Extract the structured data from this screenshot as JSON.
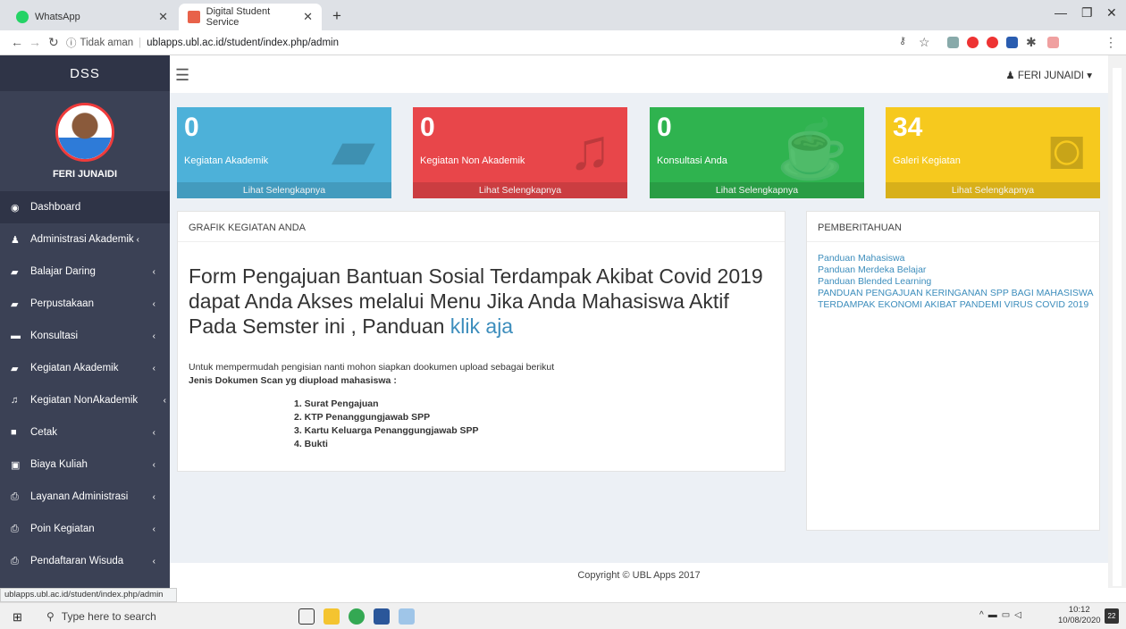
{
  "browser": {
    "tabs": [
      {
        "title": "WhatsApp",
        "color": "#25d366"
      },
      {
        "title": "Digital Student Service",
        "color": "#e8624a"
      }
    ],
    "security_label": "Tidak aman",
    "url": "ublapps.ubl.ac.id/student/index.php/admin",
    "status_url": "ublapps.ubl.ac.id/student/index.php/admin"
  },
  "sidebar": {
    "brand": "DSS",
    "user_name": "FERI JUNAIDI",
    "items": [
      {
        "label": "Dashboard",
        "icon": "dashboard-icon"
      },
      {
        "label": "Administrasi Akademik",
        "icon": "user-icon"
      },
      {
        "label": "Balajar Daring",
        "icon": "book-icon"
      },
      {
        "label": "Perpustakaan",
        "icon": "book-icon"
      },
      {
        "label": "Konsultasi",
        "icon": "board-icon"
      },
      {
        "label": "Kegiatan Akademik",
        "icon": "book-icon"
      },
      {
        "label": "Kegiatan NonAkademik",
        "icon": "music-icon"
      },
      {
        "label": "Cetak",
        "icon": "file-icon"
      },
      {
        "label": "Biaya Kuliah",
        "icon": "money-icon"
      },
      {
        "label": "Layanan Administrasi",
        "icon": "printer-icon"
      },
      {
        "label": "Poin Kegiatan",
        "icon": "printer-icon"
      },
      {
        "label": "Pendaftaran Wisuda",
        "icon": "printer-icon"
      }
    ]
  },
  "header": {
    "user": "FERI JUNAIDI"
  },
  "stats": [
    {
      "value": "0",
      "label": "Kegiatan Akademik",
      "more": "Lihat Selengkapnya",
      "color": "#4db1d9"
    },
    {
      "value": "0",
      "label": "Kegiatan Non Akademik",
      "more": "Lihat Selengkapnya",
      "color": "#e8464a"
    },
    {
      "value": "0",
      "label": "Konsultasi Anda",
      "more": "Lihat Selengkapnya",
      "color": "#2fb34f"
    },
    {
      "value": "34",
      "label": "Galeri Kegiatan",
      "more": "Lihat Selengkapnya",
      "color": "#f6c91e"
    }
  ],
  "grafik": {
    "title": "GRAFIK KEGIATAN ANDA",
    "headline": "Form Pengajuan Bantuan Sosial Terdampak Akibat Covid 2019 dapat Anda Akses melalui Menu Jika Anda Mahasiswa Aktif Pada Semster ini , Panduan",
    "headline_link": "klik aja",
    "intro": "Untuk mempermudah pengisian nanti mohon siapkan dookumen upload sebagai berikut",
    "jenis": "Jenis Dokumen Scan yg diupload mahasiswa :",
    "docs": [
      "1. Surat Pengajuan",
      "2. KTP Penanggungjawab SPP",
      "3. Kartu Keluarga Penanggungjawab SPP",
      "4. Bukti"
    ]
  },
  "notice": {
    "title": "PEMBERITAHUAN",
    "links": [
      "Panduan Mahasiswa",
      "Panduan Merdeka Belajar",
      "Panduan Blended Learning",
      "PANDUAN PENGAJUAN KERINGANAN SPP BAGI MAHASISWA TERDAMPAK EKONOMI AKIBAT PANDEMI VIRUS COVID 2019"
    ]
  },
  "footer": "Copyright © UBL Apps 2017",
  "taskbar": {
    "search_placeholder": "Type here to search",
    "time": "10:12",
    "date": "10/08/2020",
    "notifications": "22"
  }
}
